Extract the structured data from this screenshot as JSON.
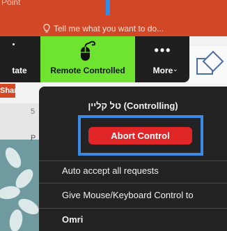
{
  "ribbon": {
    "top_text": "Point",
    "tell_me": "Tell me what you want to do..."
  },
  "sidebar": {
    "share_label": "Share",
    "tab_p": "P",
    "tab_5": "5"
  },
  "toolbar": {
    "state_label": "tate",
    "remote_label": "Remote Controlled",
    "more_label": "More",
    "more_dots": "•••",
    "remote_bg": "#6ee330"
  },
  "menu": {
    "title": "טל קליין (Controlling)",
    "abort_label": "Abort Control",
    "items": [
      "Auto accept all requests",
      "Give Mouse/Keyboard Control to",
      "Omri"
    ]
  },
  "colors": {
    "ribbon": "#d24726",
    "abort": "#e02626",
    "highlight": "#3b8be6"
  }
}
